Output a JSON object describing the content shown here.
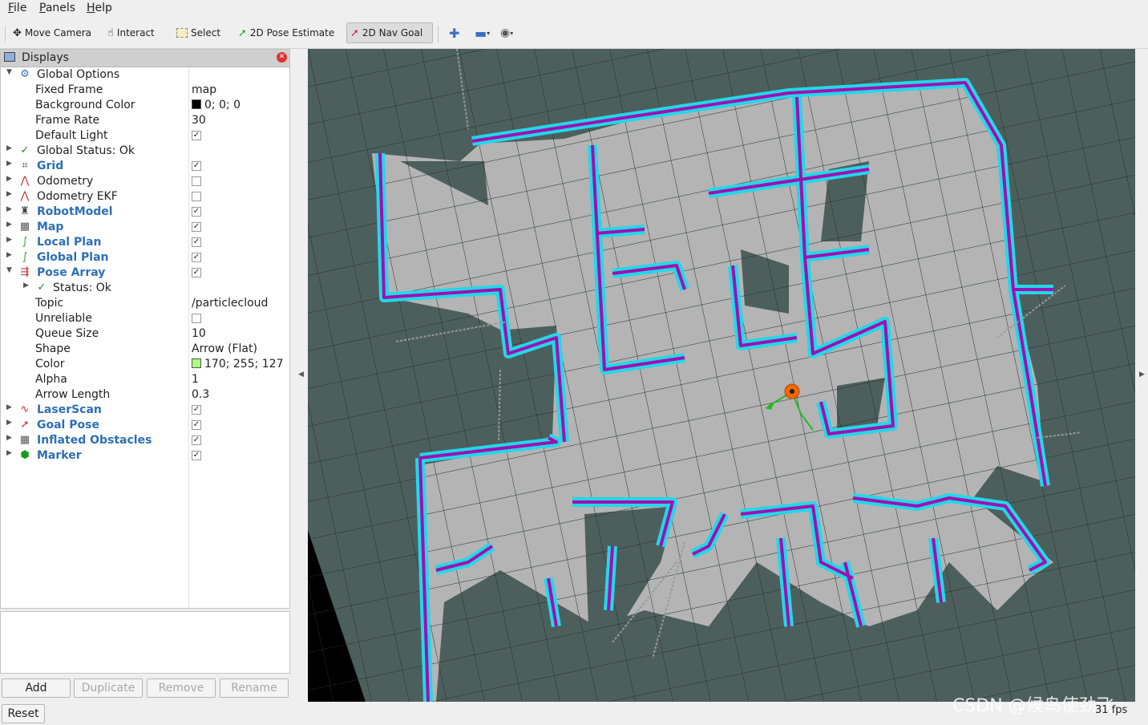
{
  "menu": {
    "file": "File",
    "panels": "Panels",
    "help": "Help"
  },
  "toolbar": {
    "move_camera": "Move Camera",
    "interact": "Interact",
    "select": "Select",
    "pose_estimate": "2D Pose Estimate",
    "nav_goal": "2D Nav Goal"
  },
  "displays": {
    "title": "Displays",
    "rows": [
      {
        "label": "Global Options"
      },
      {
        "label": "Fixed Frame",
        "value": "map"
      },
      {
        "label": "Background Color",
        "value": "0; 0; 0"
      },
      {
        "label": "Frame Rate",
        "value": "30"
      },
      {
        "label": "Default Light",
        "checked": true
      },
      {
        "label": "Global Status: Ok"
      },
      {
        "label": "Grid",
        "checked": true
      },
      {
        "label": "Odometry",
        "checked": false
      },
      {
        "label": "Odometry EKF",
        "checked": false
      },
      {
        "label": "RobotModel",
        "checked": true
      },
      {
        "label": "Map",
        "checked": true
      },
      {
        "label": "Local Plan",
        "checked": true
      },
      {
        "label": "Global Plan",
        "checked": true
      },
      {
        "label": "Pose Array",
        "checked": true
      },
      {
        "label": "Status: Ok"
      },
      {
        "label": "Topic",
        "value": "/particlecloud"
      },
      {
        "label": "Unreliable",
        "checked": false
      },
      {
        "label": "Queue Size",
        "value": "10"
      },
      {
        "label": "Shape",
        "value": "Arrow (Flat)"
      },
      {
        "label": "Color",
        "value": "170; 255; 127"
      },
      {
        "label": "Alpha",
        "value": "1"
      },
      {
        "label": "Arrow Length",
        "value": "0.3"
      },
      {
        "label": "LaserScan",
        "checked": true
      },
      {
        "label": "Goal Pose",
        "checked": true
      },
      {
        "label": "Inflated Obstacles",
        "checked": true
      },
      {
        "label": "Marker",
        "checked": true
      }
    ]
  },
  "colors": {
    "background_swatch": "#000000",
    "particle_swatch": "#aaff7f",
    "map_free": "#b4b4b4",
    "map_unknown": "#4d5f5c",
    "obstacle_inflation": "#22d8e8",
    "obstacle": "#a010b0",
    "robot": "#f06a00",
    "plan": "#22bb22"
  },
  "buttons": {
    "add": "Add",
    "duplicate": "Duplicate",
    "remove": "Remove",
    "rename": "Rename",
    "reset": "Reset"
  },
  "status": {
    "fps": "31 fps"
  },
  "watermark": "CSDN @候鸟使劲飞"
}
